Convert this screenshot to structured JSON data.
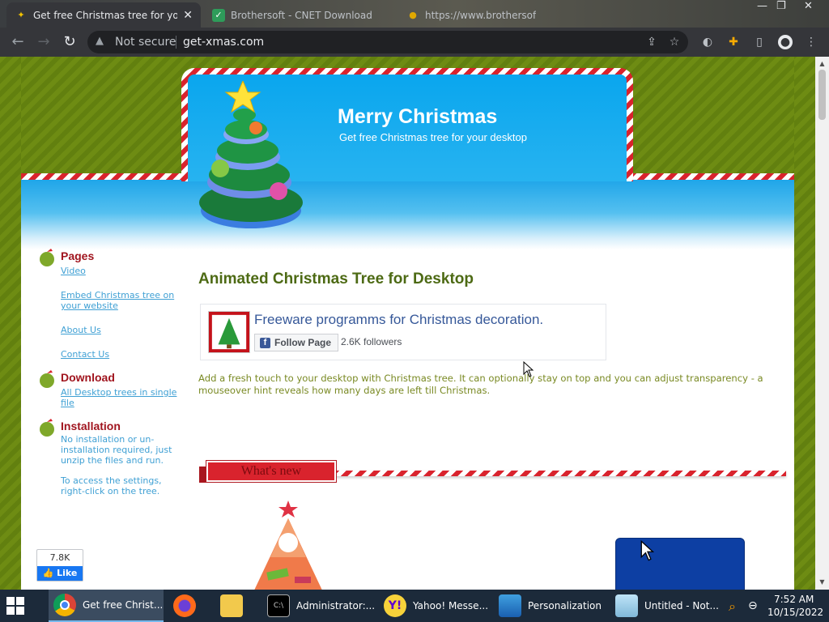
{
  "browser": {
    "tabs": [
      {
        "title": "Get free Christmas tree for your d",
        "active": true
      },
      {
        "title": "Brothersoft - CNET Download",
        "active": false
      },
      {
        "title": "https://www.brothersoftgames",
        "active": false
      }
    ],
    "close_glyph": "✕",
    "window_controls": {
      "minimize": "—",
      "restore": "❐",
      "close": "✕"
    },
    "nav": {
      "back": "←",
      "forward": "→",
      "reload": "↻"
    },
    "address": {
      "security_label": "Not secure",
      "url": "get-xmas.com"
    }
  },
  "header": {
    "title": "Merry Christmas",
    "subtitle": "Get free Christmas tree for your desktop"
  },
  "sidebar": {
    "sections": [
      {
        "heading": "Pages",
        "links": [
          "Video",
          "Embed Christmas tree on your website",
          "About Us",
          "Contact Us"
        ]
      },
      {
        "heading": "Download",
        "links": [
          "All Desktop trees in single file"
        ]
      },
      {
        "heading": "Installation",
        "text": [
          "No installation or un-installation required, just unzip the files and run.",
          "To access the settings, right-click on the tree."
        ]
      }
    ],
    "fb_like": {
      "count": "7.8K",
      "label": "Like"
    }
  },
  "main": {
    "title": "Animated Christmas Tree for Desktop",
    "facebook": {
      "page_name": "Freeware programms for Christmas decoration.",
      "follow_label": "Follow Page",
      "followers": "2.6K followers"
    },
    "description": "Add a fresh touch to your desktop with Christmas tree. It can optionally stay on top and you can adjust transparency - a mouseover hint reveals how many days are left till Christmas.",
    "whats_new": "What's new"
  },
  "taskbar": {
    "items": [
      {
        "label": "Get free Christ...",
        "icon": "chrome-icon",
        "active": true
      },
      {
        "label": "",
        "icon": "firefox-icon",
        "active": false
      },
      {
        "label": "",
        "icon": "file-explorer-icon",
        "active": false
      },
      {
        "label": "Administrator:...",
        "icon": "command-prompt-icon",
        "active": false
      },
      {
        "label": "Yahoo! Messe...",
        "icon": "yahoo-messenger-icon",
        "active": false
      },
      {
        "label": "Personalization",
        "icon": "personalization-icon",
        "active": false
      },
      {
        "label": "Untitled - Not...",
        "icon": "notepad-icon",
        "active": false
      }
    ],
    "clock": {
      "time": "7:52 AM",
      "date": "10/15/2022"
    }
  },
  "colors": {
    "accent_green": "#4d6a14",
    "heading_red": "#a0141e",
    "link_blue": "#3fa0d4",
    "header_blue": "#0aa6ee",
    "candy_red": "#d9232d"
  }
}
